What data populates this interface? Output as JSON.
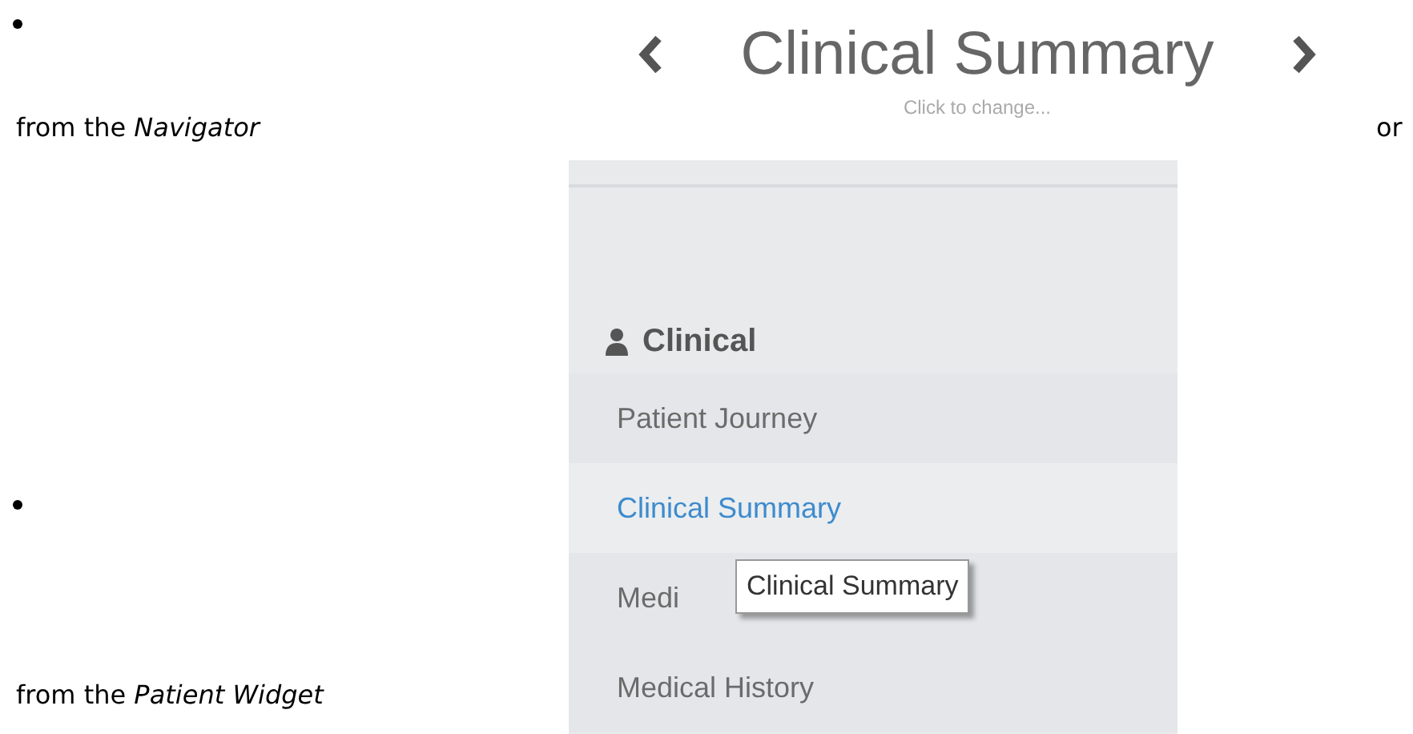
{
  "list_items": [
    {
      "text": "from the *Navigator*",
      "trailing": "or",
      "navigator": {
        "title": "Clinical Summary",
        "hint": "Click to change..."
      }
    },
    {
      "text": "from the *Patient Widget*",
      "widget": {
        "section": "Clinical",
        "tooltip": "Clinical Summary",
        "items": [
          {
            "label": "Patient Journey",
            "selected": false
          },
          {
            "label": "Clinical Summary",
            "selected": true
          },
          {
            "label": "Medi",
            "selected": false
          },
          {
            "label": "Medical History",
            "selected": false
          }
        ]
      }
    }
  ]
}
